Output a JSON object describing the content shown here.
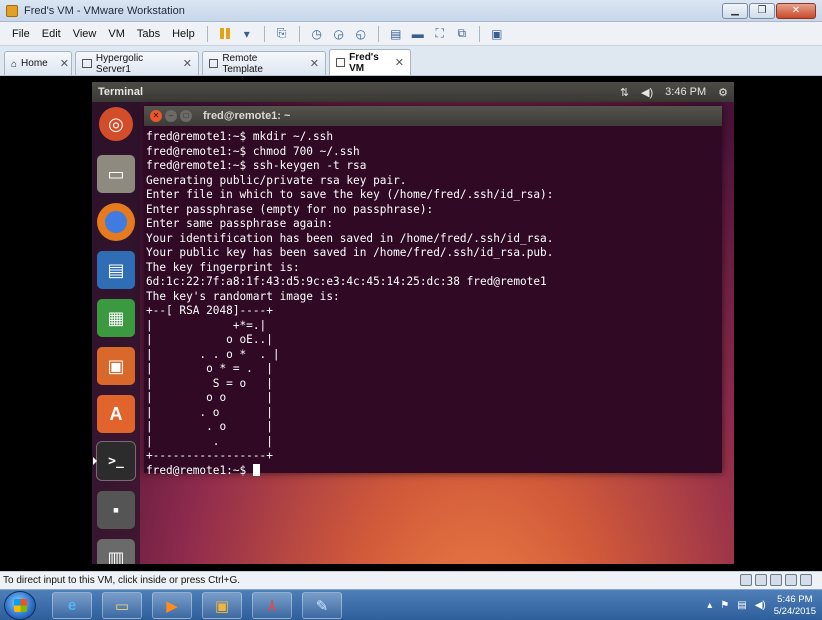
{
  "window": {
    "title": "Fred's VM - VMware Workstation"
  },
  "menu": [
    "File",
    "Edit",
    "View",
    "VM",
    "Tabs",
    "Help"
  ],
  "tabs": [
    {
      "label": "Home",
      "active": false
    },
    {
      "label": "Hypergolic Server1",
      "active": false
    },
    {
      "label": "Remote Template",
      "active": false
    },
    {
      "label": "Fred's VM",
      "active": true
    }
  ],
  "ubuntu": {
    "app_name": "Terminal",
    "time": "3:46 PM",
    "terminal_title": "fred@remote1: ~",
    "terminal_lines": [
      "fred@remote1:~$ mkdir ~/.ssh",
      "fred@remote1:~$ chmod 700 ~/.ssh",
      "fred@remote1:~$ ssh-keygen -t rsa",
      "Generating public/private rsa key pair.",
      "Enter file in which to save the key (/home/fred/.ssh/id_rsa):",
      "Enter passphrase (empty for no passphrase):",
      "Enter same passphrase again:",
      "Your identification has been saved in /home/fred/.ssh/id_rsa.",
      "Your public key has been saved in /home/fred/.ssh/id_rsa.pub.",
      "The key fingerprint is:",
      "6d:1c:22:7f:a8:1f:43:d5:9c:e3:4c:45:14:25:dc:38 fred@remote1",
      "The key's randomart image is:",
      "+--[ RSA 2048]----+",
      "|            +*=.|",
      "|           o oE..|",
      "|       . . o *  . |",
      "|        o * = .  |",
      "|         S = o   |",
      "|        o o      |",
      "|       . o       |",
      "|        . o      |",
      "|         .       |",
      "+-----------------+"
    ],
    "prompt": "fred@remote1:~$ "
  },
  "status": {
    "text": "To direct input to this VM, click inside or press Ctrl+G."
  },
  "taskbar": {
    "time": "5:46 PM",
    "date": "5/24/2015"
  }
}
